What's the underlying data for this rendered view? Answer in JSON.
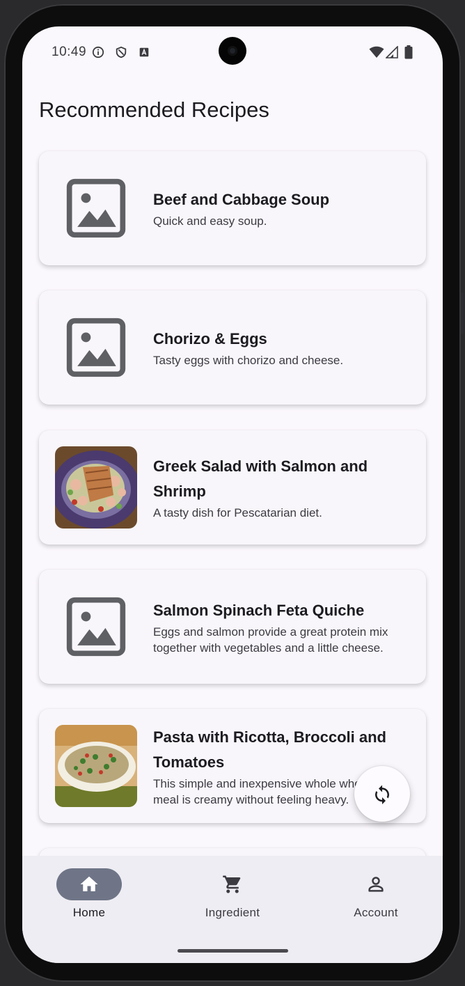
{
  "status_bar": {
    "time": "10:49"
  },
  "page": {
    "title": "Recommended Recipes"
  },
  "recipes": [
    {
      "title": "Beef and Cabbage Soup",
      "description": "Quick and easy soup.",
      "image": "placeholder-image-icon"
    },
    {
      "title": "Chorizo & Eggs",
      "description": "Tasty eggs with chorizo and cheese.",
      "image": "placeholder-image-icon"
    },
    {
      "title": "Greek Salad with Salmon and Shrimp",
      "description": "A tasty dish for Pescatarian diet.",
      "image": "salad-photo"
    },
    {
      "title": "Salmon Spinach Feta Quiche",
      "description": "Eggs and salmon provide a great protein mix together with vegetables and a little cheese.",
      "image": "placeholder-image-icon"
    },
    {
      "title": "Pasta with Ricotta, Broccoli and Tomatoes",
      "description": "This simple and inexpensive whole wheat pasta meal is creamy without feeling heavy.",
      "image": "pasta-photo"
    }
  ],
  "fab": {
    "icon": "refresh-icon"
  },
  "bottom_nav": {
    "items": [
      {
        "label": "Home",
        "icon": "home-icon",
        "active": true
      },
      {
        "label": "Ingredient",
        "icon": "cart-icon",
        "active": false
      },
      {
        "label": "Account",
        "icon": "account-icon",
        "active": false
      }
    ]
  },
  "colors": {
    "background": "#fbf8fd",
    "card": "#f8f6fb",
    "active_pill": "#6f7587",
    "nav_bar": "#eeedf3",
    "placeholder_icon": "#5f6064"
  }
}
